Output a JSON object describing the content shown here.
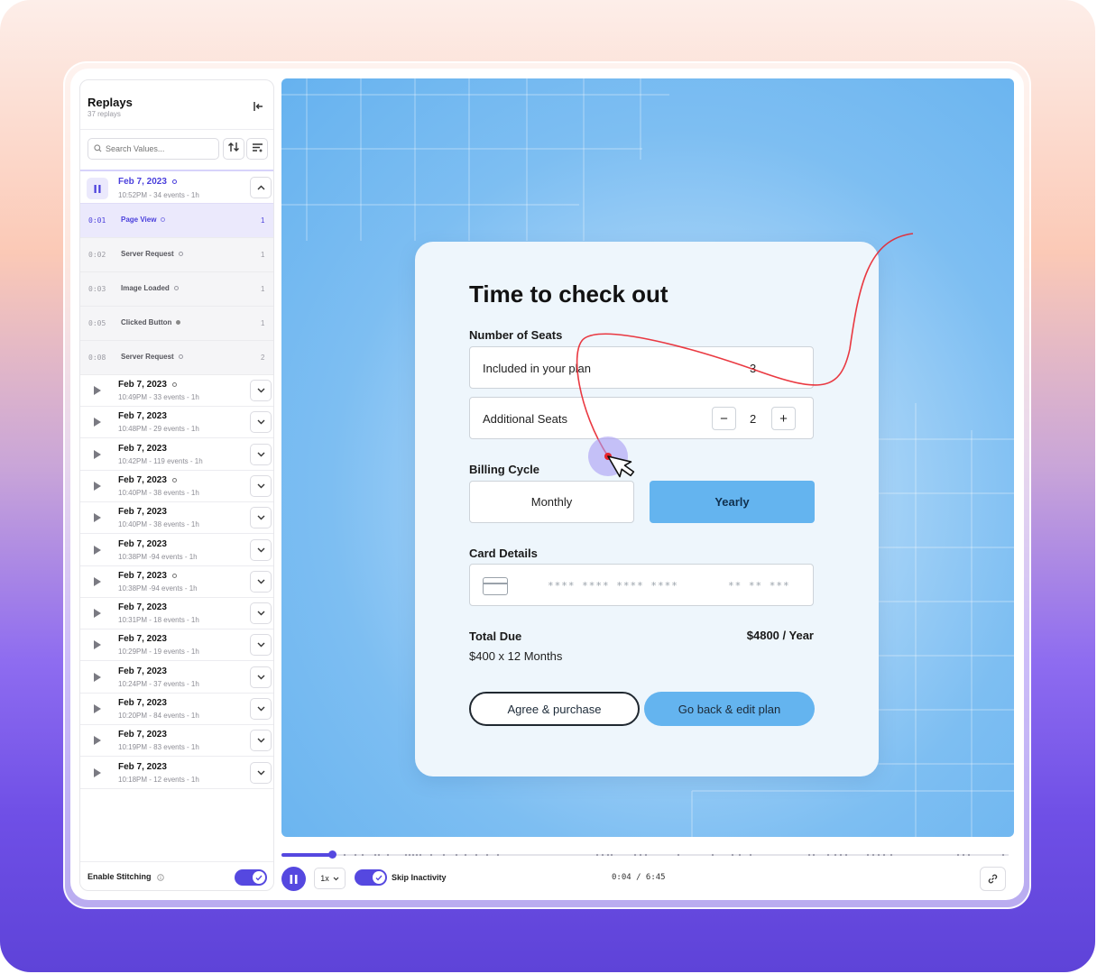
{
  "sidebar": {
    "title": "Replays",
    "subtitle": "37 replays",
    "search_placeholder": "Search Values...",
    "active_session": {
      "date": "Feb 7, 2023",
      "meta": "10:52PM - 34 events - 1h"
    },
    "events": [
      {
        "time": "0:01",
        "name": "Page View",
        "count": "1"
      },
      {
        "time": "0:02",
        "name": "Server Request",
        "count": "1"
      },
      {
        "time": "0:03",
        "name": "Image Loaded",
        "count": "1"
      },
      {
        "time": "0:05",
        "name": "Clicked Button",
        "count": "1"
      },
      {
        "time": "0:08",
        "name": "Server Request",
        "count": "2"
      }
    ],
    "sessions": [
      {
        "date": "Feb 7, 2023",
        "meta": "10:49PM - 33 events - 1h"
      },
      {
        "date": "Feb 7, 2023",
        "meta": "10:48PM - 29 events - 1h"
      },
      {
        "date": "Feb 7, 2023",
        "meta": "10:42PM - 119 events - 1h"
      },
      {
        "date": "Feb 7, 2023",
        "meta": "10:40PM - 38 events - 1h"
      },
      {
        "date": "Feb 7, 2023",
        "meta": "10:40PM - 38 events - 1h"
      },
      {
        "date": "Feb 7, 2023",
        "meta": "10:38PM -94 events - 1h"
      },
      {
        "date": "Feb 7, 2023",
        "meta": "10:38PM -94 events - 1h"
      },
      {
        "date": "Feb 7, 2023",
        "meta": "10:31PM - 18 events - 1h"
      },
      {
        "date": "Feb 7, 2023",
        "meta": "10:29PM - 19 events - 1h"
      },
      {
        "date": "Feb 7, 2023",
        "meta": "10:24PM - 37 events - 1h"
      },
      {
        "date": "Feb 7, 2023",
        "meta": "10:20PM - 84 events - 1h"
      },
      {
        "date": "Feb 7, 2023",
        "meta": "10:19PM - 83 events - 1h"
      },
      {
        "date": "Feb 7, 2023",
        "meta": "10:18PM - 12 events - 1h"
      }
    ],
    "stitching_label": "Enable Stitching"
  },
  "checkout": {
    "title": "Time to check out",
    "seats_label": "Number of Seats",
    "included_label": "Included in your plan",
    "included_value": "3",
    "additional_label": "Additional Seats",
    "additional_value": "2",
    "minus": "−",
    "plus": "+",
    "billing_label": "Billing Cycle",
    "monthly": "Monthly",
    "yearly": "Yearly",
    "card_label": "Card Details",
    "card_mask": "**** **** **** ****",
    "card_mask_tail": "**  **  ***",
    "total_label": "Total Due",
    "total_amount": "$4800 / Year",
    "total_sub": "$400 x 12 Months",
    "agree_button": "Agree & purchase",
    "back_button": "Go back & edit plan"
  },
  "player": {
    "speed": "1x",
    "skip_label": "Skip Inactivity",
    "time_readout": "0:04 / 6:45",
    "progress": 0.07
  },
  "colors": {
    "accent": "#5548e0",
    "canvas_blue": "#66b2ef",
    "yearly_button": "#64b4ef"
  },
  "icons": {
    "search": "search-icon",
    "collapse": "collapse-left-icon",
    "sort": "sort-icon",
    "filter": "filter-icon",
    "pause": "pause-icon",
    "play": "play-icon",
    "chevron": "chevron-down-icon",
    "link": "link-icon",
    "card": "credit-card-icon",
    "cursor": "mouse-cursor-icon"
  }
}
